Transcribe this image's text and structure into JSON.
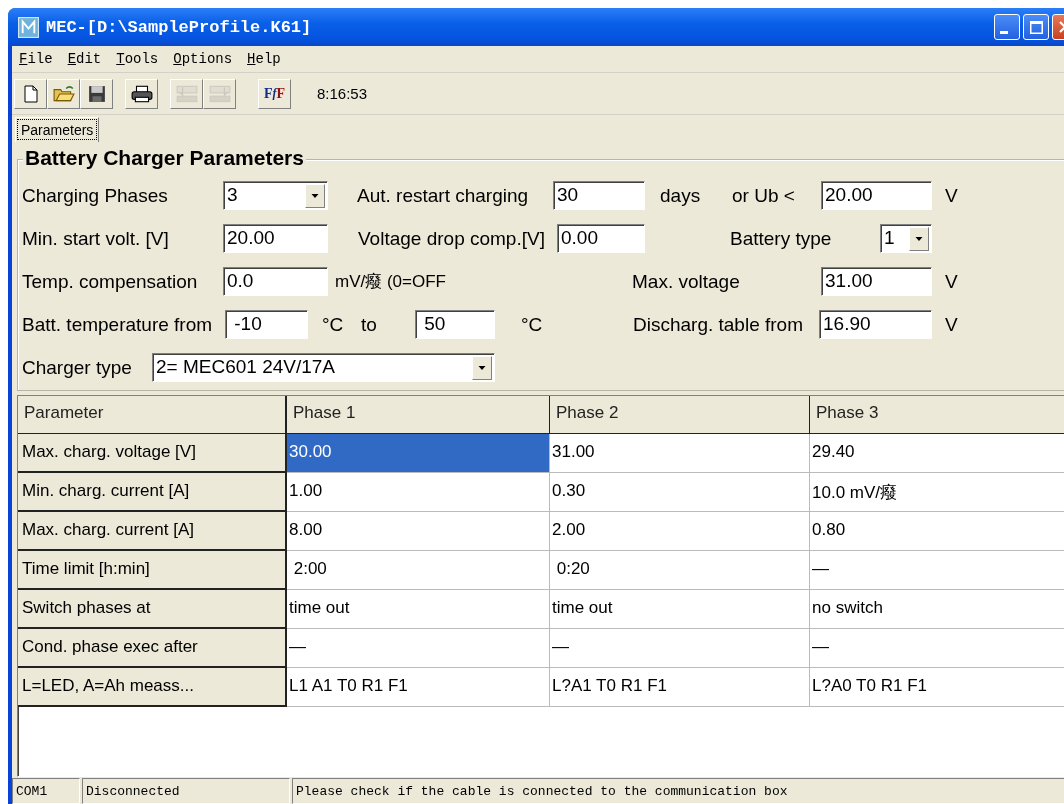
{
  "window": {
    "title": "MEC-[D:\\SampleProfile.K61]"
  },
  "menu": [
    "File",
    "Edit",
    "Tools",
    "Options",
    "Help"
  ],
  "toolbar": [
    {
      "kind": "new",
      "disabled": false
    },
    {
      "kind": "open",
      "disabled": false
    },
    {
      "kind": "save",
      "disabled": false
    },
    {
      "kind": "print",
      "disabled": false
    },
    {
      "kind": "download",
      "disabled": true
    },
    {
      "kind": "upload",
      "disabled": true
    },
    {
      "kind": "formula",
      "disabled": false,
      "label": "FfF"
    }
  ],
  "clock": "8:16:53",
  "tabs": [
    {
      "label": "Parameters",
      "selected": true
    }
  ],
  "group": {
    "title": "Battery Charger Parameters",
    "rows": [
      {
        "fields": [
          {
            "label": "Charging Phases",
            "kind": "combo",
            "value": "3"
          },
          {
            "label": "Aut. restart charging",
            "kind": "field",
            "value": "30",
            "unit": "days"
          },
          {
            "label": "or  Ub <",
            "kind": "field",
            "value": "20.00",
            "unit": "V"
          }
        ]
      },
      {
        "fields": [
          {
            "label": "Min. start volt. [V]",
            "kind": "field",
            "value": "20.00"
          },
          {
            "label": "Voltage drop comp.[V]",
            "kind": "field",
            "value": "0.00"
          },
          {
            "label": "Battery type",
            "kind": "combo",
            "value": "1"
          }
        ]
      },
      {
        "fields": [
          {
            "label": "Temp. compensation",
            "kind": "field",
            "value": "0.0",
            "unit": "mV/癈 (0=OFF"
          },
          {
            "label": "Max. voltage",
            "kind": "field",
            "value": "31.00",
            "unit": "V"
          }
        ]
      },
      {
        "fields": [
          {
            "label": "Batt. temperature from",
            "kind": "field",
            "value": " -10",
            "unit": "°C"
          },
          {
            "label": "to",
            "kind": "field",
            "value": " 50",
            "unit": "°C"
          },
          {
            "label": "Discharg. table from",
            "kind": "field",
            "value": "16.90",
            "unit": "V"
          }
        ]
      },
      {
        "fields": [
          {
            "label": "Charger type",
            "kind": "combo",
            "value": "2= MEC601 24V/17A"
          }
        ]
      }
    ]
  },
  "table": {
    "columns": [
      "Parameter",
      "Phase 1",
      "Phase 2",
      "Phase 3"
    ],
    "rows": [
      {
        "cells": [
          {
            "kind": "header",
            "text": "Max. charg. voltage [V]",
            "selected": false
          },
          {
            "kind": "value",
            "text": "30.00",
            "selected": true
          },
          {
            "kind": "value",
            "text": "31.00",
            "selected": false
          },
          {
            "kind": "value",
            "text": "29.40",
            "selected": false
          }
        ]
      },
      {
        "cells": [
          {
            "kind": "header",
            "text": "Min. charg. current [A]",
            "selected": false
          },
          {
            "kind": "value",
            "text": "1.00",
            "selected": false
          },
          {
            "kind": "value",
            "text": "0.30",
            "selected": false
          },
          {
            "kind": "value",
            "text": "10.0 mV/癈",
            "selected": false
          }
        ]
      },
      {
        "cells": [
          {
            "kind": "header",
            "text": "Max. charg. current [A]",
            "selected": false
          },
          {
            "kind": "value",
            "text": "8.00",
            "selected": false
          },
          {
            "kind": "value",
            "text": "2.00",
            "selected": false
          },
          {
            "kind": "value",
            "text": "0.80",
            "selected": false
          }
        ]
      },
      {
        "cells": [
          {
            "kind": "header",
            "text": "Time limit [h:min]",
            "selected": false
          },
          {
            "kind": "value",
            "text": " 2:00",
            "selected": false
          },
          {
            "kind": "value",
            "text": " 0:20",
            "selected": false
          },
          {
            "kind": "value",
            "text": "—",
            "selected": false
          }
        ]
      },
      {
        "cells": [
          {
            "kind": "header",
            "text": "Switch phases at",
            "selected": false
          },
          {
            "kind": "value",
            "text": "time out",
            "selected": false
          },
          {
            "kind": "value",
            "text": "time out",
            "selected": false
          },
          {
            "kind": "value",
            "text": "no switch",
            "selected": false
          }
        ]
      },
      {
        "cells": [
          {
            "kind": "header",
            "text": "Cond. phase exec after",
            "selected": false
          },
          {
            "kind": "value",
            "text": "—",
            "selected": false
          },
          {
            "kind": "value",
            "text": "—",
            "selected": false
          },
          {
            "kind": "value",
            "text": "—",
            "selected": false
          }
        ]
      },
      {
        "cells": [
          {
            "kind": "header",
            "text": "L=LED, A=Ah meass...",
            "selected": false
          },
          {
            "kind": "value",
            "text": "L1 A1 T0 R1 F1",
            "selected": false
          },
          {
            "kind": "value",
            "text": "L?A1 T0 R1 F1",
            "selected": false
          },
          {
            "kind": "value",
            "text": "L?A0 T0 R1 F1",
            "selected": false
          }
        ]
      }
    ]
  },
  "status_bar": [
    "COM1",
    "Disconnected",
    "Please check if the cable is connected to the communication box"
  ]
}
